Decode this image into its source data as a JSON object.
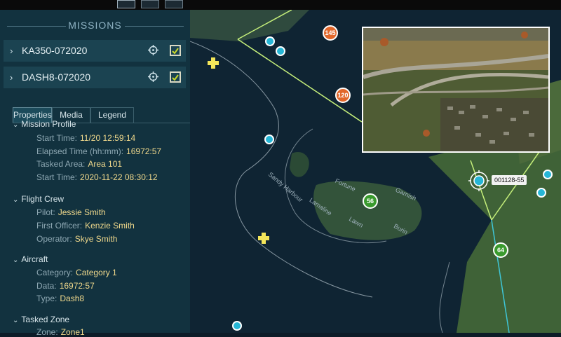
{
  "sidebar": {
    "title": "MISSIONS",
    "missions": [
      {
        "name": "KA350-072020"
      },
      {
        "name": "DASH8-072020"
      }
    ],
    "tabs": [
      "Properties",
      "Media",
      "Legend"
    ],
    "sections": {
      "mission_profile": {
        "title": "Mission Profile",
        "rows": [
          {
            "label": "Start Time:",
            "value": "11/20 12:59:14"
          },
          {
            "label": "Elapsed Time (hh:mm):",
            "value": "16972:57"
          },
          {
            "label": "Tasked Area:",
            "value": "Area 101"
          },
          {
            "label": "Start Time:",
            "value": "2020-11-22 08:30:12"
          }
        ]
      },
      "flight_crew": {
        "title": "Flight Crew",
        "rows": [
          {
            "label": "Pilot:",
            "value": "Jessie Smith"
          },
          {
            "label": "First Officer:",
            "value": "Kenzie Smith"
          },
          {
            "label": "Operator:",
            "value": "Skye Smith"
          }
        ]
      },
      "aircraft": {
        "title": "Aircraft",
        "rows": [
          {
            "label": "Category:",
            "value": "Category 1"
          },
          {
            "label": "Data:",
            "value": "16972:57"
          },
          {
            "label": "Type:",
            "value": "Dash8"
          }
        ]
      },
      "tasked_zone": {
        "title": "Tasked Zone",
        "rows": [
          {
            "label": "Zone:",
            "value": "Zone1"
          }
        ]
      }
    }
  },
  "map": {
    "markers": [
      "145",
      "120",
      "56",
      "64"
    ],
    "tag": "001128-55",
    "place_labels": [
      "Sandy Harbour",
      "Fortune",
      "Garnish",
      "Lamaline",
      "Lawn",
      "Burin"
    ]
  },
  "colors": {
    "sidebar_bg": "#12323f",
    "mission_bg": "#1b4351",
    "value_text": "#f0d98c",
    "marker_orange": "#e2672a",
    "marker_green": "#3a9a2e",
    "marker_cyan": "#26b6d6",
    "zone_green": "#c6f07b",
    "zone_cyan": "#3fc6d8"
  }
}
